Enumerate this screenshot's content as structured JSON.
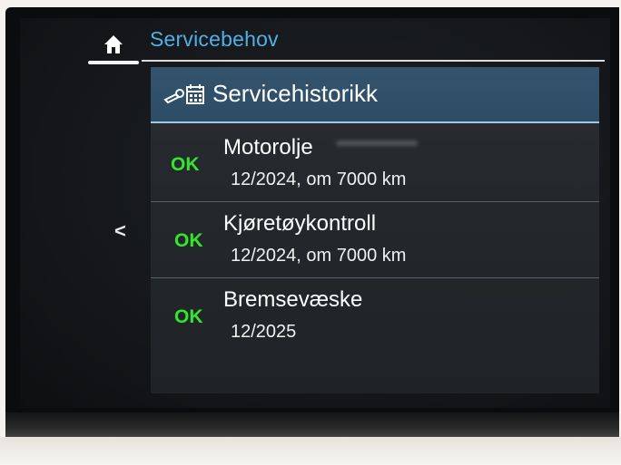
{
  "header": {
    "home_icon": "home-icon",
    "title": "Servicebehov"
  },
  "panel": {
    "icon": "service-history-icon",
    "title": "Servicehistorikk"
  },
  "items": [
    {
      "status": "OK",
      "title": "Motorolje",
      "detail": "12/2024, om 7000 km"
    },
    {
      "status": "OK",
      "title": "Kjøretøykontroll",
      "detail": "12/2024, om 7000 km"
    },
    {
      "status": "OK",
      "title": "Bremsevæske",
      "detail": "12/2025"
    }
  ],
  "nav": {
    "back_icon": "chevron-left-icon",
    "back_glyph": "<"
  },
  "colors": {
    "accent_blue": "#4fb0e8",
    "status_ok": "#33e52c",
    "panel_header": "#2d4d66"
  }
}
